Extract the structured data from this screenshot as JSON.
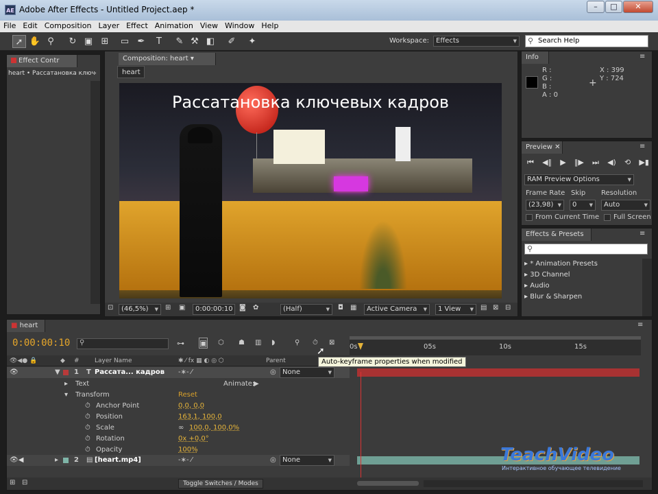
{
  "window": {
    "title": "Adobe After Effects - Untitled Project.aep *",
    "logo": "AE"
  },
  "menu": [
    "File",
    "Edit",
    "Composition",
    "Layer",
    "Effect",
    "Animation",
    "View",
    "Window",
    "Help"
  ],
  "toolbar": {
    "workspace_label": "Workspace:",
    "workspace_value": "Effects",
    "search_placeholder": "Search Help"
  },
  "effect_controls": {
    "tab": "Effect Contr",
    "layer_path": "heart • Рассатановка ключе"
  },
  "composition": {
    "tab": "Composition: heart",
    "subtab": "heart",
    "overlay_text": "Рассатановка ключевых кадров",
    "bottom": {
      "zoom": "(46,5%)",
      "time": "0:00:00:10",
      "resolution": "(Half)",
      "camera": "Active Camera",
      "view": "1 View"
    }
  },
  "info": {
    "tab": "Info",
    "r": "R :",
    "g": "G :",
    "b": "B :",
    "a": "A : 0",
    "x": "X : 399",
    "y": "Y : 724"
  },
  "preview": {
    "tab": "Preview",
    "ram": "RAM Preview Options",
    "frame_rate_label": "Frame Rate",
    "skip_label": "Skip",
    "resolution_label": "Resolution",
    "frame_rate": "(23,98)",
    "skip": "0",
    "resolution": "Auto",
    "from_current": "From Current Time",
    "full_screen": "Full Screen"
  },
  "effects_presets": {
    "tab": "Effects & Presets",
    "items": [
      "* Animation Presets",
      "3D Channel",
      "Audio",
      "Blur & Sharpen"
    ]
  },
  "timeline": {
    "tab": "heart",
    "time": "0:00:00:10",
    "tooltip": "Auto-keyframe properties when modified",
    "ruler": [
      "0s",
      "05s",
      "10s",
      "15s"
    ],
    "col_layer_name": "Layer Name",
    "col_parent": "Parent",
    "col_hash": "#",
    "layers": [
      {
        "num": "1",
        "name": "Рассата... кадров",
        "parent": "None",
        "color": "#b83a3a"
      },
      {
        "num": "2",
        "name": "[heart.mp4]",
        "parent": "None",
        "color": "#7fb5a8"
      }
    ],
    "text_row": "Text",
    "animate": "Animate:",
    "transform": "Transform",
    "reset": "Reset",
    "props": [
      {
        "name": "Anchor Point",
        "value": "0,0, 0,0"
      },
      {
        "name": "Position",
        "value": "163,1, 100,0"
      },
      {
        "name": "Scale",
        "value": "100,0, 100,0%"
      },
      {
        "name": "Rotation",
        "value": "0x +0,0°"
      },
      {
        "name": "Opacity",
        "value": "100%"
      }
    ],
    "toggle": "Toggle Switches / Modes"
  },
  "watermark": {
    "brand": "TeachVideo",
    "sub": "Интерактивное обучающее телевидение"
  }
}
